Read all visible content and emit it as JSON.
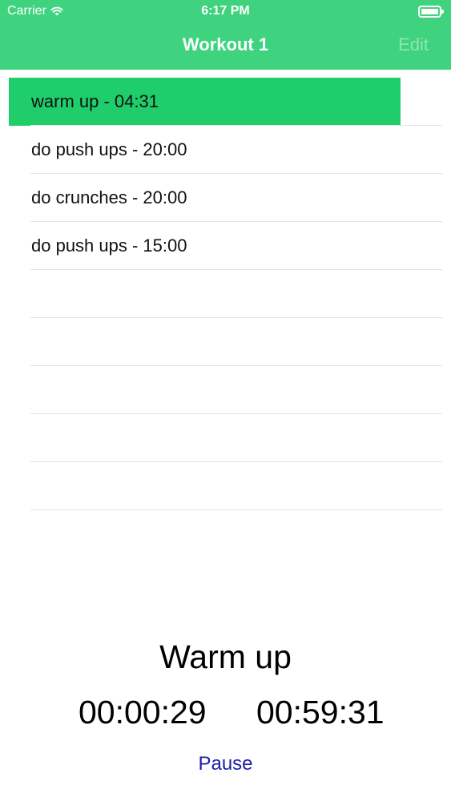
{
  "status_bar": {
    "carrier": "Carrier",
    "time": "6:17 PM",
    "wifi_icon": "wifi-icon",
    "battery_icon": "battery-icon"
  },
  "nav": {
    "title": "Workout 1",
    "edit_label": "Edit"
  },
  "list": {
    "items": [
      {
        "label": "warm up - 04:31",
        "active": true
      },
      {
        "label": "do push ups - 20:00",
        "active": false
      },
      {
        "label": "do crunches - 20:00",
        "active": false
      },
      {
        "label": "do push ups - 15:00",
        "active": false
      }
    ]
  },
  "player": {
    "exercise_name": "Warm up",
    "elapsed": "00:00:29",
    "remaining": "00:59:31",
    "pause_label": "Pause"
  },
  "colors": {
    "header": "#3fd37f",
    "active_row": "#1fcd6b",
    "pause_text": "#1c1fa8"
  }
}
